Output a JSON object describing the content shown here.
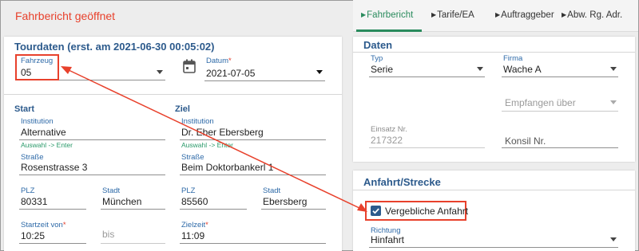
{
  "banner": "Fahrbericht geöffnet",
  "tabs": [
    {
      "label": "Fahrbericht"
    },
    {
      "label": "Tarife/EA"
    },
    {
      "label": "Auftraggeber"
    },
    {
      "label": "Abw. Rg. Adr."
    }
  ],
  "tour": {
    "title": "Tourdaten (erst. am 2021-06-30 00:05:02)",
    "vehicle_label": "Fahrzeug",
    "vehicle_value": "05",
    "date_label": "Datum",
    "date_value": "2021-07-05",
    "start_heading": "Start",
    "dest_heading": "Ziel",
    "start": {
      "institution_label": "Institution",
      "institution_value": "Alternative",
      "hint": "Auswahl -> Enter",
      "street_label": "Straße",
      "street_value": "Rosenstrasse 3",
      "zip_label": "PLZ",
      "zip_value": "80331",
      "city_label": "Stadt",
      "city_value": "München"
    },
    "dest": {
      "institution_label": "Institution",
      "institution_value": "Dr. Eber Ebersberg",
      "hint": "Auswahl -> Enter",
      "street_label": "Straße",
      "street_value": "Beim Doktorbankerl 1",
      "zip_label": "PLZ",
      "zip_value": "85560",
      "city_label": "Stadt",
      "city_value": "Ebersberg"
    },
    "start_time_label": "Startzeit von",
    "start_time_value": "10:25",
    "until_placeholder": "bis",
    "target_time_label": "Zielzeit",
    "target_time_value": "11:09",
    "required_mark": "*"
  },
  "daten": {
    "title": "Daten",
    "type_label": "Typ",
    "type_value": "Serie",
    "company_label": "Firma",
    "company_value": "Wache A",
    "received_placeholder": "Empfangen über",
    "mission_label": "Einsatz Nr.",
    "mission_value": "217322",
    "konsil_placeholder": "Konsil Nr."
  },
  "route": {
    "title": "Anfahrt/Strecke",
    "futile_label": "Vergebliche Anfahrt",
    "futile_checked": true,
    "direction_label": "Richtung",
    "direction_value": "Hinfahrt"
  },
  "colors": {
    "accent_green": "#2a8b5d",
    "title_blue": "#2c5a8c",
    "label_blue": "#2e6aa8",
    "annotation_red": "#e8412c"
  }
}
